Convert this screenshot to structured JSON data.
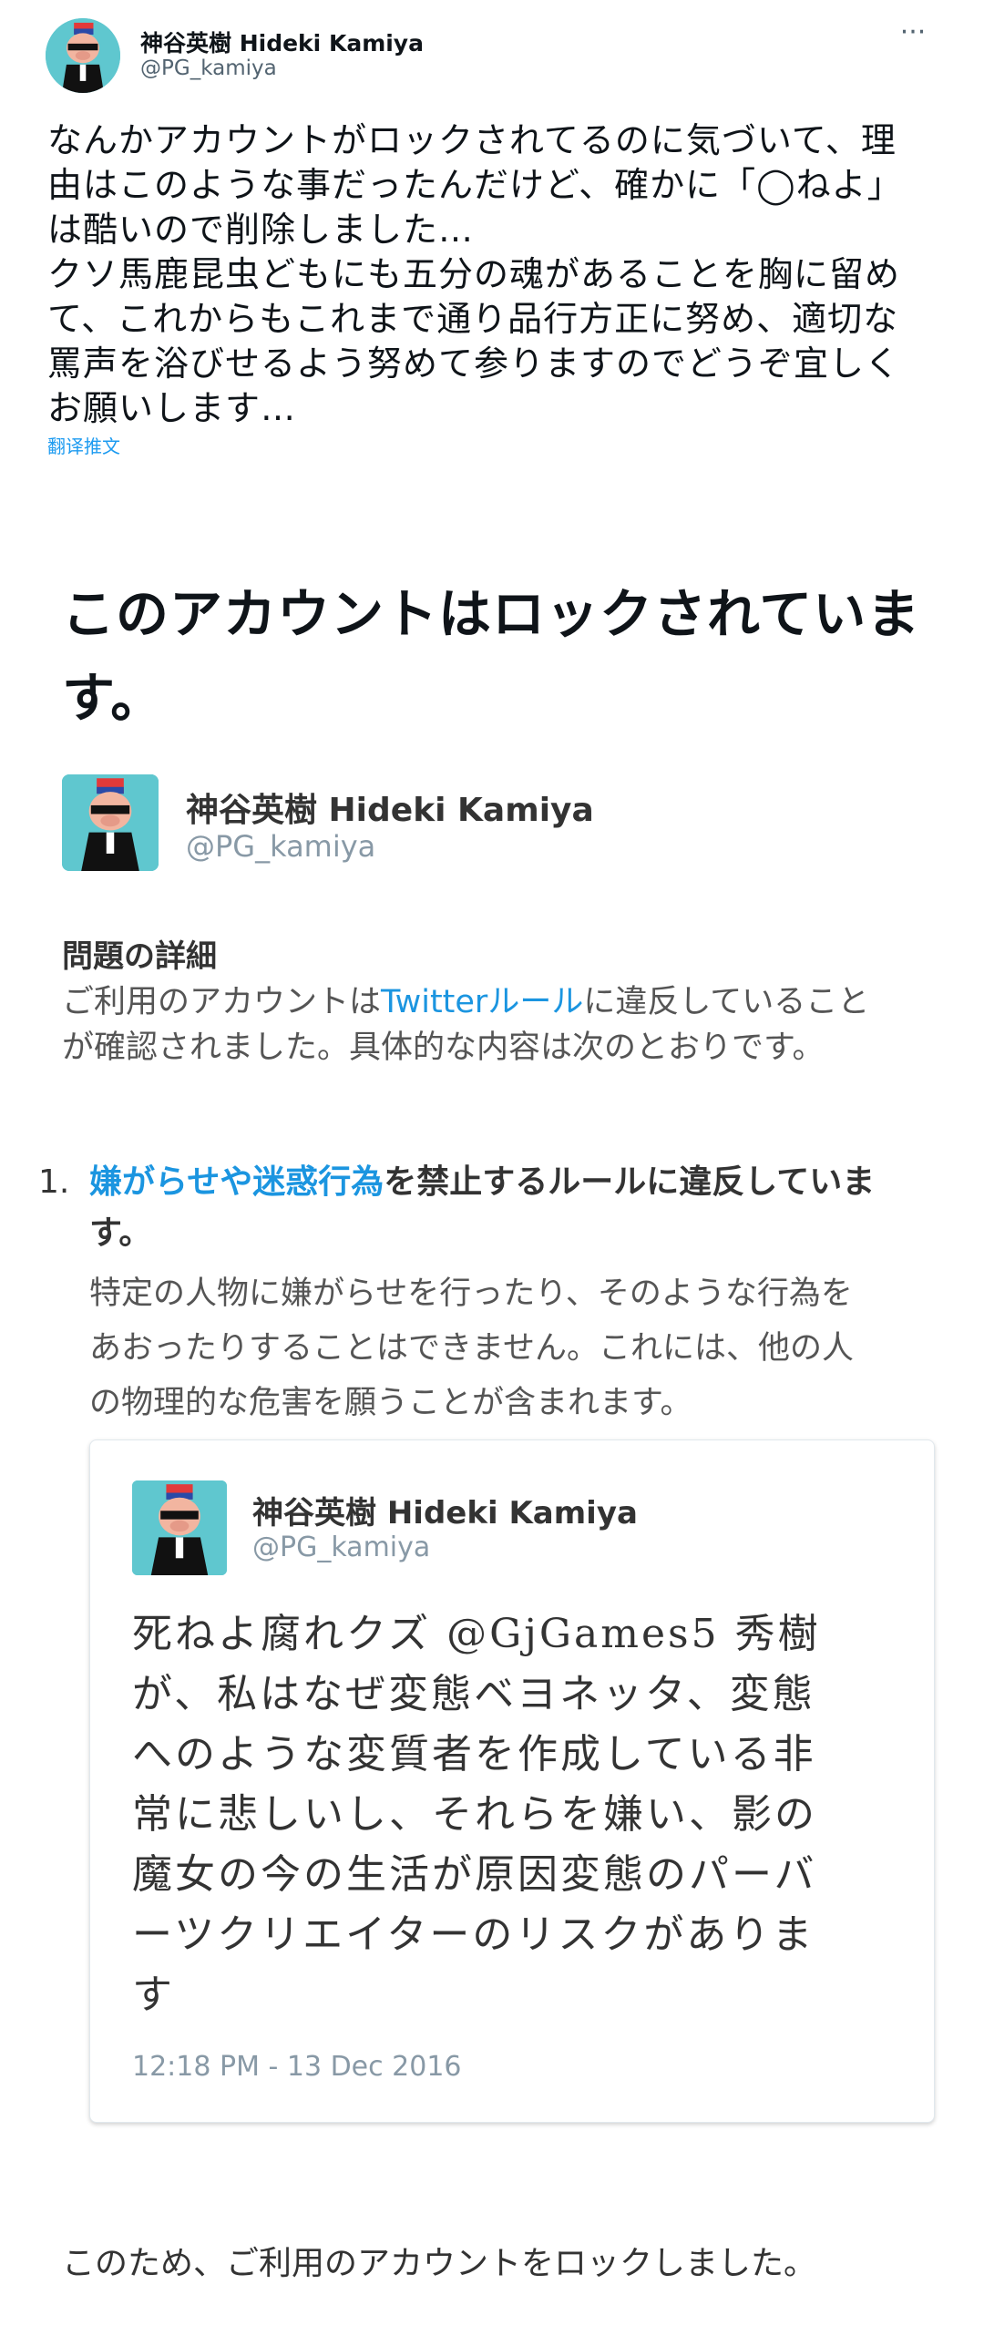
{
  "tweet": {
    "author_name": "神谷英樹 Hideki Kamiya",
    "author_handle": "@PG_kamiya",
    "more_icon": "more-horizontal-icon",
    "text": "なんかアカウントがロックされてるのに気づいて、理\n由はこのような事だったんだけど、確かに「◯ねよ」\nは酷いので削除しました…\nクソ馬鹿昆虫どもにも五分の魂があることを胸に留め\nて、これからもこれまで通り品行方正に努め、適切な\n罵声を浴びせるよう努めて参りますのでどうぞ宜しく\nお願いします…",
    "translate_label": "翻译推文"
  },
  "notice": {
    "title": "このアカウントはロックされていま\nす。",
    "profile": {
      "name": "神谷英樹 Hideki Kamiya",
      "handle": "@PG_kamiya"
    },
    "details_heading": "問題の詳細",
    "details_pre": "ご利用のアカウントは",
    "details_link": "Twitterルール",
    "details_post": "に違反していること\nが確認されました。具体的な内容は次のとおりです。",
    "rule": {
      "number": "1.",
      "link": "嫌がらせや迷惑行為",
      "title_post": "を禁止するルールに違反していま\nす。",
      "description": "特定の人物に嫌がらせを行ったり、そのような行為を\nあおったりすることはできません。これには、他の人\nの物理的な危害を願うことが含まれます。"
    },
    "quoted_tweet": {
      "name": "神谷英樹 Hideki Kamiya",
      "handle": "@PG_kamiya",
      "text": "死ねよ腐れクズ @GjGames5 秀樹\nが、私はなぜ変態ベヨネッタ、変態\nへのような変質者を作成している非\n常に悲しいし、それらを嫌い、影の\n魔女の今の生活が原因変態のパーバ\nーツクリエイターのリスクがありま\nす",
      "timestamp": "12:18 PM - 13 Dec 2016"
    },
    "footer": "このため、ご利用のアカウントをロックしました。"
  },
  "colors": {
    "link": "#1b95e0",
    "avatar_bg": "#5fc7cf",
    "muted": "#8899a6"
  }
}
